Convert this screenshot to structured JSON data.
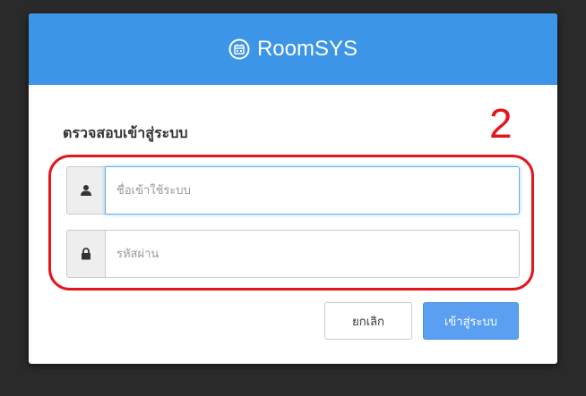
{
  "header": {
    "app_name": "RoomSYS",
    "logo_icon": "calendar-clock-icon",
    "background": "#3c95e6"
  },
  "login": {
    "heading": "ตรวจสอบเข้าสู่ระบบ",
    "username": {
      "icon": "user-icon",
      "placeholder": "ชื่อเข้าใช้ระบบ",
      "value": ""
    },
    "password": {
      "icon": "lock-icon",
      "placeholder": "รหัสผ่าน",
      "value": ""
    }
  },
  "buttons": {
    "cancel_label": "ยกเลิก",
    "login_label": "เข้าสู่ระบบ",
    "login_color": "#5b9ff2"
  },
  "annotation": {
    "number": "2",
    "color": "#e3161c"
  }
}
